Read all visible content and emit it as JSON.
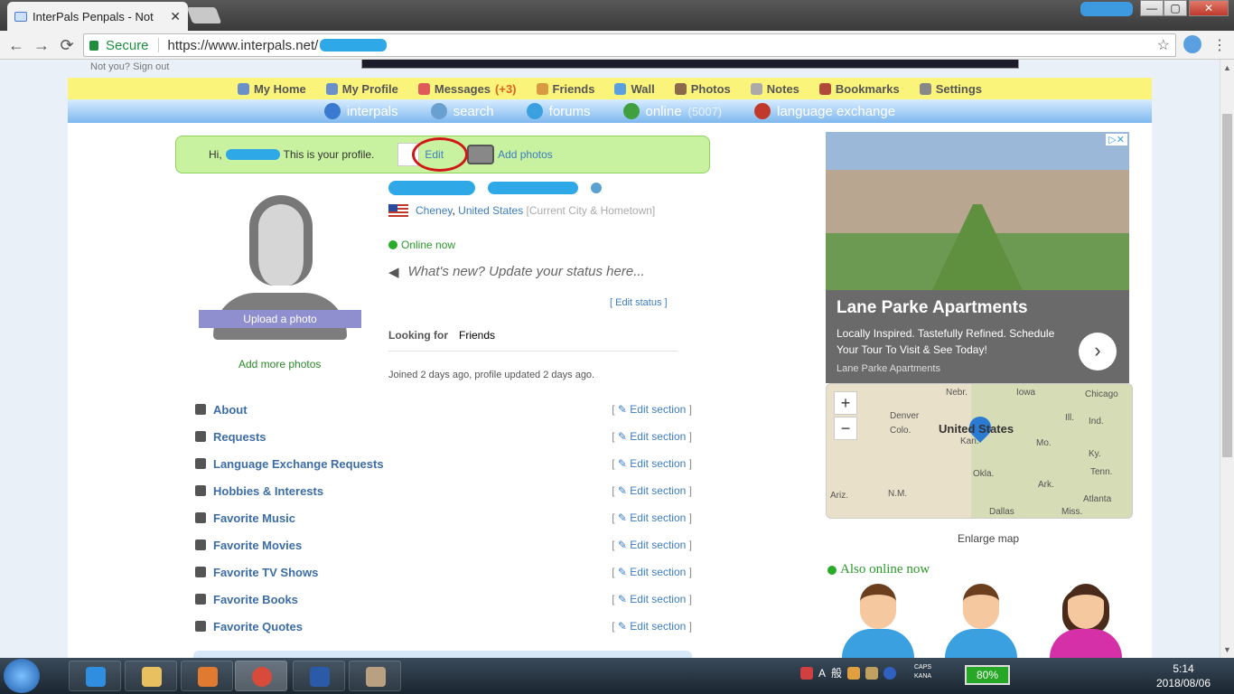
{
  "browser": {
    "tab_title": "InterPals Penpals - Not",
    "tab_close": "✕",
    "secure_label": "Secure",
    "url": "https://www.interpals.net/",
    "star": "☆",
    "back": "←",
    "forward": "→",
    "reload": "⟳",
    "menu": "⋮",
    "win_minimize": "—",
    "win_maximize": "▢",
    "win_close": "✕"
  },
  "page": {
    "signout_text": "Not you? Sign out"
  },
  "main_nav": [
    {
      "label": "My Home",
      "icon": "home-icon",
      "color": "#6b8fc8"
    },
    {
      "label": "My Profile",
      "icon": "profile-icon",
      "color": "#6b8fc8"
    },
    {
      "label": "Messages",
      "count": "(+3)",
      "icon": "envelope-icon",
      "color": "#e05a5a"
    },
    {
      "label": "Friends",
      "icon": "friends-icon",
      "color": "#d89a40"
    },
    {
      "label": "Wall",
      "icon": "wall-icon",
      "color": "#5aa0e0"
    },
    {
      "label": "Photos",
      "icon": "photos-icon",
      "color": "#8a6a4a"
    },
    {
      "label": "Notes",
      "icon": "notes-icon",
      "color": "#aaaaaa"
    },
    {
      "label": "Bookmarks",
      "icon": "bookmarks-icon",
      "color": "#b04a3a"
    },
    {
      "label": "Settings",
      "icon": "settings-icon",
      "color": "#888888"
    }
  ],
  "sub_nav": [
    {
      "label": "interpals",
      "icon": "globe-icon",
      "color": "#3a7ad0"
    },
    {
      "label": "search",
      "icon": "magnifier-icon",
      "color": "#6aa0d0"
    },
    {
      "label": "forums",
      "icon": "speech-bubble-icon",
      "color": "#3aa0e0"
    },
    {
      "label": "online",
      "count": "(5007)",
      "icon": "online-users-icon",
      "color": "#40a040"
    },
    {
      "label": "language exchange",
      "icon": "flags-icon",
      "color": "#c0392b"
    }
  ],
  "welcome": {
    "greeting": "Hi,",
    "text": "This is your profile.",
    "edit": "Edit",
    "add_photos": "Add photos"
  },
  "profile": {
    "upload_photo": "Upload a photo",
    "add_more_photos": "Add more photos",
    "city": "Cheney",
    "country": "United States",
    "location_hint": "[Current City & Hometown]",
    "online_now": "Online now",
    "status_placeholder": "What's new? Update your status here...",
    "edit_status": "[ Edit status ]",
    "looking_for_label": "Looking for",
    "looking_for_value": "Friends",
    "joined": "Joined 2 days ago, profile updated 2 days ago."
  },
  "sections": [
    {
      "label": "About",
      "icon": "user-icon"
    },
    {
      "label": "Requests",
      "icon": "checkbox-icon"
    },
    {
      "label": "Language Exchange Requests",
      "icon": "flag-icon"
    },
    {
      "label": "Hobbies & Interests",
      "icon": "puzzle-icon"
    },
    {
      "label": "Favorite Music",
      "icon": "music-note-icon"
    },
    {
      "label": "Favorite Movies",
      "icon": "film-icon"
    },
    {
      "label": "Favorite TV Shows",
      "icon": "tv-icon"
    },
    {
      "label": "Favorite Books",
      "icon": "book-icon"
    },
    {
      "label": "Favorite Quotes",
      "icon": "quote-icon"
    }
  ],
  "section_edit_label": "Edit section",
  "ad": {
    "title": "Lane Parke Apartments",
    "text": "Locally Inspired. Tastefully Refined. Schedule Your Tour To Visit & See Today!",
    "source": "Lane Parke Apartments",
    "adchoices": "▷✕",
    "next": "›"
  },
  "map": {
    "zoom_in": "+",
    "zoom_out": "−",
    "labels": [
      "Nebr.",
      "Iowa",
      "Chicago",
      "Denver",
      "Colo.",
      "United States",
      "Kan.",
      "Ill.",
      "Ind.",
      "Mo.",
      "Ky.",
      "Okla.",
      "Tenn.",
      "Ark.",
      "Ariz.",
      "N.M.",
      "Atlanta",
      "Dallas",
      "Miss."
    ],
    "enlarge": "Enlarge map"
  },
  "also_online": "Also online now",
  "taskbar": {
    "battery": "80%",
    "ime_a": "A",
    "ime_kanji": "般",
    "caps": "CAPS",
    "kana": "KANA",
    "time": "5:14",
    "date": "2018/08/06"
  }
}
